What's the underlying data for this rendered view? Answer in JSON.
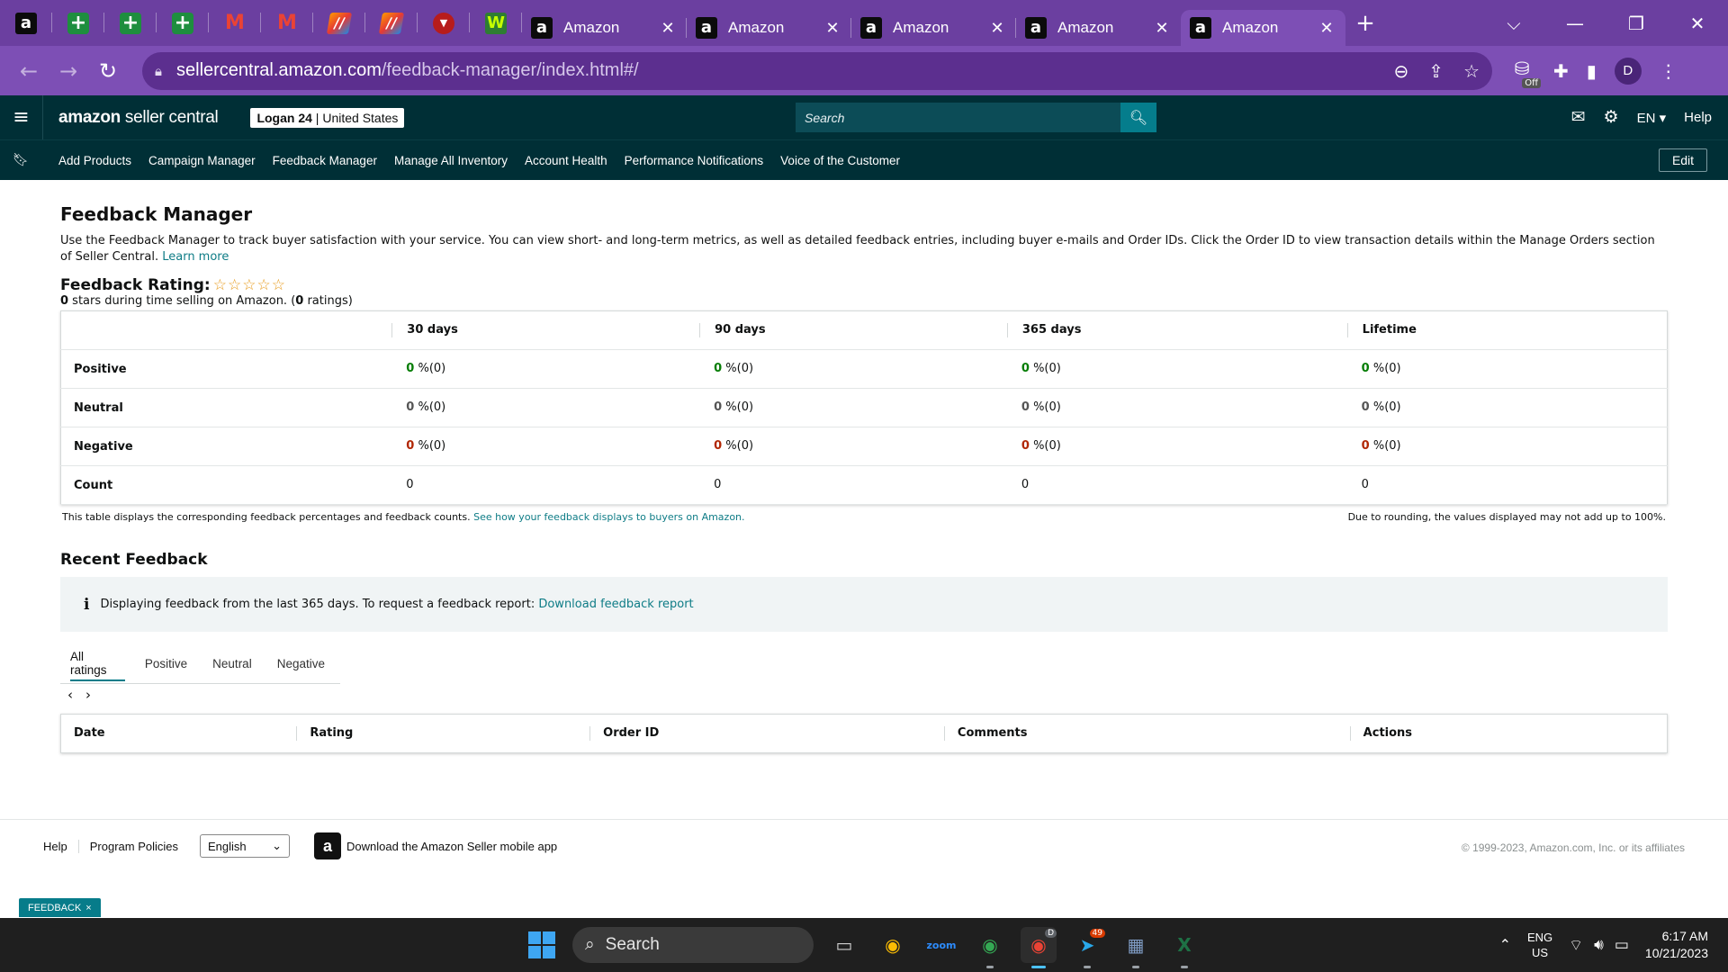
{
  "browser": {
    "pinned_tabs": [
      {
        "icon": "amazon-favicon",
        "glyph": "a",
        "style": "fav-amz"
      },
      {
        "icon": "google-sheets-favicon",
        "glyph": "+",
        "style": "fav-plus"
      },
      {
        "icon": "google-sheets-favicon",
        "glyph": "+",
        "style": "fav-plus"
      },
      {
        "icon": "google-sheets-favicon",
        "glyph": "+",
        "style": "fav-plus"
      },
      {
        "icon": "gmail-favicon",
        "glyph": "M",
        "style": "fav-gmail"
      },
      {
        "icon": "gmail-favicon",
        "glyph": "M",
        "style": "fav-gmail"
      },
      {
        "icon": "gradient-app-favicon",
        "glyph": "//",
        "style": "fav-grad"
      },
      {
        "icon": "gradient-app-favicon",
        "glyph": "//",
        "style": "fav-grad"
      },
      {
        "icon": "red-badge-favicon",
        "glyph": "▼",
        "style": "fav-red"
      },
      {
        "icon": "w-app-favicon",
        "glyph": "W",
        "style": "fav-w"
      }
    ],
    "tabs": [
      {
        "title": "Amazon",
        "active": false
      },
      {
        "title": "Amazon",
        "active": false
      },
      {
        "title": "Amazon",
        "active": false
      },
      {
        "title": "Amazon",
        "active": false
      },
      {
        "title": "Amazon",
        "active": true
      }
    ],
    "url_host": "sellercentral.amazon.com",
    "url_path": "/feedback-manager/index.html#/",
    "profile_initial": "D",
    "extension_badge": "Off"
  },
  "header": {
    "logo_bold": "amazon",
    "logo_light": " seller central",
    "store_name": "Logan 24",
    "store_region": "United States",
    "search_placeholder": "Search",
    "language": "EN",
    "help": "Help"
  },
  "nav": {
    "links": [
      "Add Products",
      "Campaign Manager",
      "Feedback Manager",
      "Manage All Inventory",
      "Account Health",
      "Performance Notifications",
      "Voice of the Customer"
    ],
    "edit": "Edit"
  },
  "page": {
    "title": "Feedback Manager",
    "intro": "Use the Feedback Manager to track buyer satisfaction with your service. You can view short- and long-term metrics, as well as detailed feedback entries, including buyer e-mails and Order IDs. Click the Order ID to view transaction details within the Manage Orders section of Seller Central.",
    "learn_more": "Learn more",
    "rating_label": "Feedback Rating:",
    "rating_stars": 0,
    "rating_max": 5,
    "rating_sub_stars": "0",
    "rating_sub_mid": " stars during time selling on Amazon. (",
    "rating_sub_count": "0",
    "rating_sub_end": " ratings)"
  },
  "feedback_table": {
    "columns": [
      "30 days",
      "90 days",
      "365 days",
      "Lifetime"
    ],
    "rows": [
      {
        "label": "Positive",
        "kind": "green",
        "cells": [
          {
            "num": "0",
            "rest": " %(0)"
          },
          {
            "num": "0",
            "rest": " %(0)"
          },
          {
            "num": "0",
            "rest": " %(0)"
          },
          {
            "num": "0",
            "rest": " %(0)"
          }
        ]
      },
      {
        "label": "Neutral",
        "kind": "grey",
        "cells": [
          {
            "num": "0",
            "rest": " %(0)"
          },
          {
            "num": "0",
            "rest": " %(0)"
          },
          {
            "num": "0",
            "rest": " %(0)"
          },
          {
            "num": "0",
            "rest": " %(0)"
          }
        ]
      },
      {
        "label": "Negative",
        "kind": "red",
        "cells": [
          {
            "num": "0",
            "rest": " %(0)"
          },
          {
            "num": "0",
            "rest": " %(0)"
          },
          {
            "num": "0",
            "rest": " %(0)"
          },
          {
            "num": "0",
            "rest": " %(0)"
          }
        ]
      },
      {
        "label": "Count",
        "kind": "plain",
        "cells": [
          {
            "num": "0",
            "rest": ""
          },
          {
            "num": "0",
            "rest": ""
          },
          {
            "num": "0",
            "rest": ""
          },
          {
            "num": "0",
            "rest": ""
          }
        ]
      }
    ],
    "note_left": "This table displays the corresponding feedback percentages and feedback counts.",
    "note_link": "See how your feedback displays to buyers on Amazon.",
    "note_right": "Due to rounding, the values displayed may not add up to 100%."
  },
  "recent": {
    "title": "Recent Feedback",
    "info_text": "Displaying feedback from the last 365 days. To request a feedback report:",
    "info_link": "Download feedback report",
    "filters": [
      {
        "label": "All ratings",
        "active": true
      },
      {
        "label": "Positive",
        "active": false
      },
      {
        "label": "Neutral",
        "active": false
      },
      {
        "label": "Negative",
        "active": false
      }
    ],
    "columns": [
      "Date",
      "Rating",
      "Order ID",
      "Comments",
      "Actions"
    ]
  },
  "footer": {
    "links": [
      "Help",
      "Program Policies"
    ],
    "language_select": "English",
    "app_text": "Download the Amazon Seller mobile app",
    "copyright": "© 1999-2023, Amazon.com, Inc. or its affiliates",
    "feedback_tab": "FEEDBACK"
  },
  "taskbar": {
    "search": "Search",
    "telegram_badge": "49",
    "chrome_profile_badge": "D",
    "lang_top": "ENG",
    "lang_bottom": "US",
    "time": "6:17 AM",
    "date": "10/21/2023"
  },
  "colors": {
    "browser_tabstrip": "#6b3fa0",
    "browser_toolbar": "#7d4fb5",
    "sc_header": "#002f36",
    "positive": "#067d06",
    "negative": "#b12704",
    "link": "#0e7c86"
  }
}
